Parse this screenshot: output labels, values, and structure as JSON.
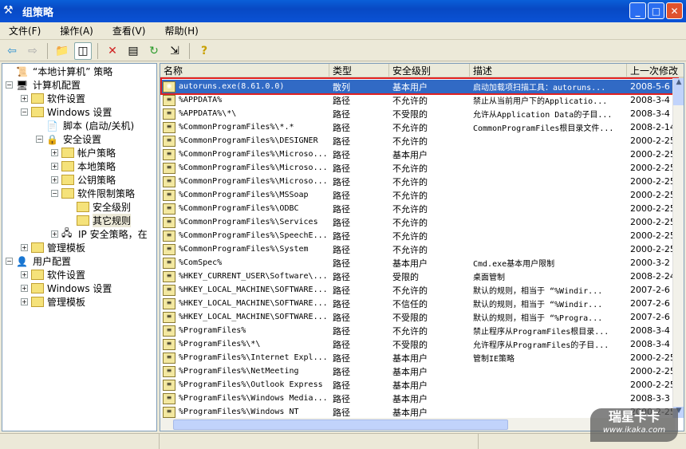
{
  "window": {
    "title": "组策略"
  },
  "menu": [
    "文件(F)",
    "操作(A)",
    "查看(V)",
    "帮助(H)"
  ],
  "toolbar": [
    "back-icon",
    "forward-icon",
    "up-folder-icon",
    "show-hide-tree-icon",
    "delete-icon",
    "properties-icon",
    "refresh-icon",
    "export-list-icon",
    "help-icon"
  ],
  "tree": [
    {
      "label": "“本地计算机” 策略",
      "level": 0,
      "exp": "",
      "icon": "policy"
    },
    {
      "label": "计算机配置",
      "level": 0,
      "exp": "-",
      "icon": "computer"
    },
    {
      "label": "软件设置",
      "level": 1,
      "exp": "+",
      "icon": "folder"
    },
    {
      "label": "Windows 设置",
      "level": 1,
      "exp": "-",
      "icon": "folder"
    },
    {
      "label": "脚本 (启动/关机)",
      "level": 2,
      "exp": "",
      "icon": "script"
    },
    {
      "label": "安全设置",
      "level": 2,
      "exp": "-",
      "icon": "secure"
    },
    {
      "label": "帐户策略",
      "level": 3,
      "exp": "+",
      "icon": "folder"
    },
    {
      "label": "本地策略",
      "level": 3,
      "exp": "+",
      "icon": "folder"
    },
    {
      "label": "公钥策略",
      "level": 3,
      "exp": "+",
      "icon": "folder"
    },
    {
      "label": "软件限制策略",
      "level": 3,
      "exp": "-",
      "icon": "folder"
    },
    {
      "label": "安全级别",
      "level": 4,
      "exp": "",
      "icon": "folder"
    },
    {
      "label": "其它规则",
      "level": 4,
      "exp": "",
      "icon": "folder",
      "selected": true
    },
    {
      "label": "IP 安全策略，在",
      "level": 3,
      "exp": "+",
      "icon": "ip"
    },
    {
      "label": "管理模板",
      "level": 1,
      "exp": "+",
      "icon": "folder"
    },
    {
      "label": "用户配置",
      "level": 0,
      "exp": "-",
      "icon": "user"
    },
    {
      "label": "软件设置",
      "level": 1,
      "exp": "+",
      "icon": "folder"
    },
    {
      "label": "Windows 设置",
      "level": 1,
      "exp": "+",
      "icon": "folder"
    },
    {
      "label": "管理模板",
      "level": 1,
      "exp": "+",
      "icon": "folder"
    }
  ],
  "columns": [
    "名称",
    "类型",
    "安全级别",
    "描述",
    "上一次修改"
  ],
  "rows": [
    [
      "autoruns.exe(8.61.0.0)",
      "散列",
      "基本用户",
      "启动加载项扫描工具：autoruns...",
      "2008-5-6"
    ],
    [
      "%APPDATA%",
      "路径",
      "不允许的",
      "禁止从当前用户下的Applicatio...",
      "2008-3-4"
    ],
    [
      "%APPDATA%\\*\\",
      "路径",
      "不受限的",
      "允许从Application Data的子目...",
      "2008-3-4"
    ],
    [
      "%CommonProgramFiles%\\*.*",
      "路径",
      "不允许的",
      "CommonProgramFiles根目录文件...",
      "2008-2-14"
    ],
    [
      "%CommonProgramFiles%\\DESIGNER",
      "路径",
      "不允许的",
      "",
      "2000-2-25"
    ],
    [
      "%CommonProgramFiles%\\Microso...",
      "路径",
      "基本用户",
      "",
      "2000-2-25"
    ],
    [
      "%CommonProgramFiles%\\Microso...",
      "路径",
      "不允许的",
      "",
      "2000-2-25"
    ],
    [
      "%CommonProgramFiles%\\Microso...",
      "路径",
      "不允许的",
      "",
      "2000-2-25"
    ],
    [
      "%CommonProgramFiles%\\MSSoap",
      "路径",
      "不允许的",
      "",
      "2000-2-25"
    ],
    [
      "%CommonProgramFiles%\\ODBC",
      "路径",
      "不允许的",
      "",
      "2000-2-25"
    ],
    [
      "%CommonProgramFiles%\\Services",
      "路径",
      "不允许的",
      "",
      "2000-2-25"
    ],
    [
      "%CommonProgramFiles%\\SpeechE...",
      "路径",
      "不允许的",
      "",
      "2000-2-25"
    ],
    [
      "%CommonProgramFiles%\\System",
      "路径",
      "不允许的",
      "",
      "2000-2-25"
    ],
    [
      "%ComSpec%",
      "路径",
      "基本用户",
      "Cmd.exe基本用户限制",
      "2000-3-2"
    ],
    [
      "%HKEY_CURRENT_USER\\Software\\...",
      "路径",
      "受限的",
      "桌面管制",
      "2008-2-24"
    ],
    [
      "%HKEY_LOCAL_MACHINE\\SOFTWARE...",
      "路径",
      "不允许的",
      "默认的规则，相当于 “%Windir...",
      "2007-2-6"
    ],
    [
      "%HKEY_LOCAL_MACHINE\\SOFTWARE...",
      "路径",
      "不信任的",
      "默认的规则，相当于 “%Windir...",
      "2007-2-6"
    ],
    [
      "%HKEY_LOCAL_MACHINE\\SOFTWARE...",
      "路径",
      "不受限的",
      "默认的规则，相当于 “%Progra...",
      "2007-2-6"
    ],
    [
      "%ProgramFiles%",
      "路径",
      "不允许的",
      "禁止程序从ProgramFiles根目录...",
      "2008-3-4"
    ],
    [
      "%ProgramFiles%\\*\\",
      "路径",
      "不受限的",
      "允许程序从ProgramFiles的子目...",
      "2008-3-4"
    ],
    [
      "%ProgramFiles%\\Internet Expl...",
      "路径",
      "基本用户",
      "管制IE策略",
      "2000-2-25"
    ],
    [
      "%ProgramFiles%\\NetMeeting",
      "路径",
      "基本用户",
      "",
      "2000-2-25"
    ],
    [
      "%ProgramFiles%\\Outlook Express",
      "路径",
      "基本用户",
      "",
      "2000-2-25"
    ],
    [
      "%ProgramFiles%\\Windows Media...",
      "路径",
      "基本用户",
      "",
      "2008-3-3"
    ],
    [
      "%ProgramFiles%\\Windows NT",
      "路径",
      "基本用户",
      "",
      "2000-2-25"
    ]
  ],
  "watermark": {
    "brand": "瑞星卡卡",
    "url": "www.ikaka.com"
  }
}
